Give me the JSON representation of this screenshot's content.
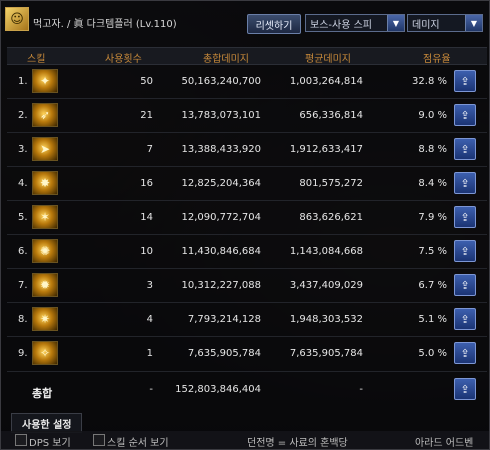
{
  "header": {
    "title": "먹고자. / 眞 다크템플러 (Lv.110)",
    "reset_label": "리셋하기",
    "target_select": "보스-사용 스피",
    "metric_select": "데미지"
  },
  "columns": [
    "스킬",
    "사용횟수",
    "총합데미지",
    "평균데미지",
    "점유율"
  ],
  "rows": [
    {
      "idx": "1.",
      "uses": "50",
      "total": "50,163,240,700",
      "avg": "1,003,264,814",
      "share": "32.8 %",
      "icon": "skill-1-icon"
    },
    {
      "idx": "2.",
      "uses": "21",
      "total": "13,783,073,101",
      "avg": "656,336,814",
      "share": "9.0 %",
      "icon": "skill-2-icon"
    },
    {
      "idx": "3.",
      "uses": "7",
      "total": "13,388,433,920",
      "avg": "1,912,633,417",
      "share": "8.8 %",
      "icon": "skill-3-icon"
    },
    {
      "idx": "4.",
      "uses": "16",
      "total": "12,825,204,364",
      "avg": "801,575,272",
      "share": "8.4 %",
      "icon": "skill-4-icon"
    },
    {
      "idx": "5.",
      "uses": "14",
      "total": "12,090,772,704",
      "avg": "863,626,621",
      "share": "7.9 %",
      "icon": "skill-5-icon"
    },
    {
      "idx": "6.",
      "uses": "10",
      "total": "11,430,846,684",
      "avg": "1,143,084,668",
      "share": "7.5 %",
      "icon": "skill-6-icon"
    },
    {
      "idx": "7.",
      "uses": "3",
      "total": "10,312,227,088",
      "avg": "3,437,409,029",
      "share": "6.7 %",
      "icon": "skill-7-icon"
    },
    {
      "idx": "8.",
      "uses": "4",
      "total": "7,793,214,128",
      "avg": "1,948,303,532",
      "share": "5.1 %",
      "icon": "skill-8-icon"
    },
    {
      "idx": "9.",
      "uses": "1",
      "total": "7,635,905,784",
      "avg": "7,635,905,784",
      "share": "5.0 %",
      "icon": "skill-9-icon"
    }
  ],
  "total": {
    "label": "총합",
    "uses": "-",
    "total": "152,803,846,404",
    "avg": "-"
  },
  "footer": {
    "used_setting": "사용한 설정",
    "dps_label": "DPS 보기",
    "skill_order_label": "스킬 순서 보기",
    "dungeon_label": "던전명 = 사료의 혼백당",
    "right_label": "아라드 어드벤"
  },
  "colors": {
    "header_text": "#c88a3a",
    "accent_button": "#3d5fae"
  }
}
